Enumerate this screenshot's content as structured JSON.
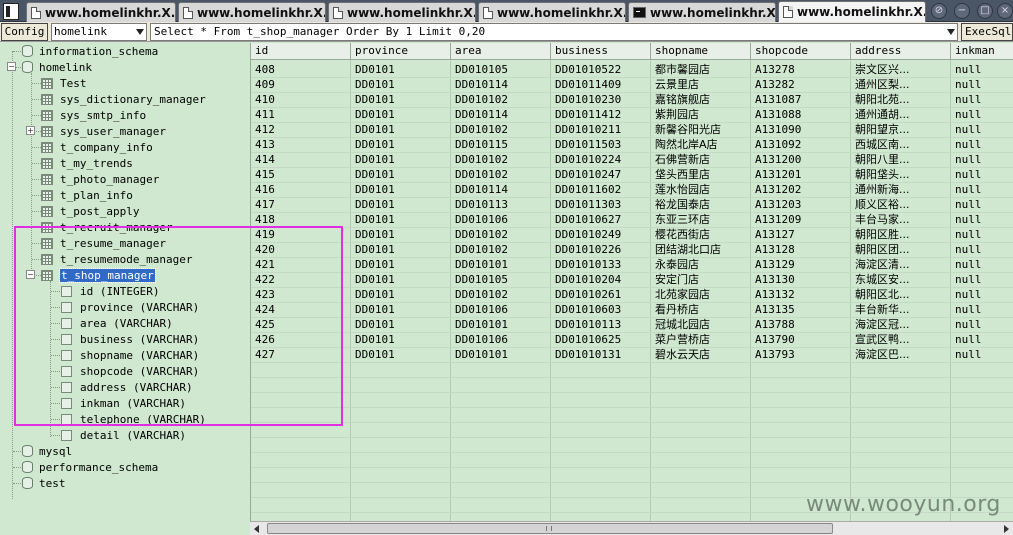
{
  "tabs": [
    {
      "title": "www.homelinkhr.X...",
      "icon": "document-icon",
      "active": false
    },
    {
      "title": "www.homelinkhr.X...",
      "icon": "document-icon",
      "active": false
    },
    {
      "title": "www.homelinkhr.X...",
      "icon": "document-icon",
      "active": false
    },
    {
      "title": "www.homelinkhr.X...",
      "icon": "document-icon",
      "active": false
    },
    {
      "title": "www.homelinkhr.X...",
      "icon": "terminal-icon",
      "active": false
    },
    {
      "title": "www.homelinkhr.X...",
      "icon": "document-icon",
      "active": true
    }
  ],
  "toolbar": {
    "config_label": "Config",
    "database": "homelink",
    "sql": "Select * From t_shop_manager Order By 1 Limit 0,20",
    "exec_label": "ExecSql"
  },
  "tree": {
    "databases": [
      "information_schema",
      "homelink",
      "mysql",
      "performance_schema",
      "test"
    ],
    "tables": [
      "Test",
      "sys_dictionary_manager",
      "sys_smtp_info",
      "sys_user_manager",
      "t_company_info",
      "t_my_trends",
      "t_photo_manager",
      "t_plan_info",
      "t_post_apply",
      "t_recruit_manager",
      "t_resume_manager",
      "t_resumemode_manager",
      "t_shop_manager"
    ],
    "selected_table": "t_shop_manager",
    "columns": [
      "id (INTEGER)",
      "province (VARCHAR)",
      "area (VARCHAR)",
      "business (VARCHAR)",
      "shopname (VARCHAR)",
      "shopcode (VARCHAR)",
      "address (VARCHAR)",
      "inkman (VARCHAR)",
      "telephone (VARCHAR)",
      "detail (VARCHAR)"
    ]
  },
  "grid": {
    "headers": [
      "id",
      "province",
      "area",
      "business",
      "shopname",
      "shopcode",
      "address",
      "inkman"
    ],
    "rows": [
      [
        "408",
        "DD0101",
        "DD010105",
        "DD01010522",
        "都市馨园店",
        "A13278",
        "崇文区兴...",
        "null"
      ],
      [
        "409",
        "DD0101",
        "DD010114",
        "DD01011409",
        "云景里店",
        "A13282",
        "通州区梨...",
        "null"
      ],
      [
        "410",
        "DD0101",
        "DD010102",
        "DD01010230",
        "嘉铭旗舰店",
        "A131087",
        "朝阳北苑...",
        "null"
      ],
      [
        "411",
        "DD0101",
        "DD010114",
        "DD01011412",
        "紫荆园店",
        "A131088",
        "通州通胡...",
        "null"
      ],
      [
        "412",
        "DD0101",
        "DD010102",
        "DD01010211",
        "新馨谷阳光店",
        "A131090",
        "朝阳望京...",
        "null"
      ],
      [
        "413",
        "DD0101",
        "DD010115",
        "DD01011503",
        "陶然北岸A店",
        "A131092",
        "西城区南...",
        "null"
      ],
      [
        "414",
        "DD0101",
        "DD010102",
        "DD01010224",
        "石佛营新店",
        "A131200",
        "朝阳八里...",
        "null"
      ],
      [
        "415",
        "DD0101",
        "DD010102",
        "DD01010247",
        "垡头西里店",
        "A131201",
        "朝阳垡头...",
        "null"
      ],
      [
        "416",
        "DD0101",
        "DD010114",
        "DD01011602",
        "莲水怡园店",
        "A131202",
        "通州新海...",
        "null"
      ],
      [
        "417",
        "DD0101",
        "DD010113",
        "DD01011303",
        "裕龙国泰店",
        "A131203",
        "顺义区裕...",
        "null"
      ],
      [
        "418",
        "DD0101",
        "DD010106",
        "DD01010627",
        "东亚三环店",
        "A131209",
        "丰台马家...",
        "null"
      ],
      [
        "419",
        "DD0101",
        "DD010102",
        "DD01010249",
        "樱花西街店",
        "A13127",
        "朝阳区胜...",
        "null"
      ],
      [
        "420",
        "DD0101",
        "DD010102",
        "DD01010226",
        "团结湖北口店",
        "A13128",
        "朝阳区团...",
        "null"
      ],
      [
        "421",
        "DD0101",
        "DD010101",
        "DD01010133",
        "永泰园店",
        "A13129",
        "海淀区清...",
        "null"
      ],
      [
        "422",
        "DD0101",
        "DD010105",
        "DD01010204",
        "安定门店",
        "A13130",
        "东城区安...",
        "null"
      ],
      [
        "423",
        "DD0101",
        "DD010102",
        "DD01010261",
        "北苑家园店",
        "A13132",
        "朝阳区北...",
        "null"
      ],
      [
        "424",
        "DD0101",
        "DD010106",
        "DD01010603",
        "看丹桥店",
        "A13135",
        "丰台新华...",
        "null"
      ],
      [
        "425",
        "DD0101",
        "DD010101",
        "DD01010113",
        "冠城北园店",
        "A13788",
        "海淀区冠...",
        "null"
      ],
      [
        "426",
        "DD0101",
        "DD010106",
        "DD01010625",
        "菜户营桥店",
        "A13790",
        "宣武区鸭...",
        "null"
      ],
      [
        "427",
        "DD0101",
        "DD010101",
        "DD01010131",
        "碧水云天店",
        "A13793",
        "海淀区巴...",
        "null"
      ]
    ]
  },
  "watermark": "www.wooyun.org",
  "colors": {
    "background": "#cfe8cf",
    "highlight_box": "#e22ee2",
    "selection": "#3169c6",
    "tabbar": "#4a5566"
  }
}
